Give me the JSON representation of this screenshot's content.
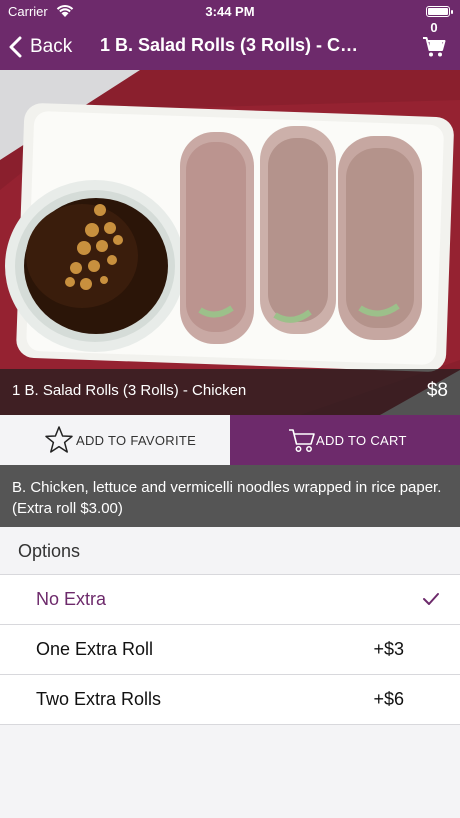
{
  "status_bar": {
    "carrier": "Carrier",
    "time": "3:44 PM"
  },
  "nav": {
    "back_label": "Back",
    "title": "1 B. Salad Rolls (3 Rolls) - Chicken",
    "cart_count": "0"
  },
  "item": {
    "name": "1 B. Salad Rolls (3 Rolls) - Chicken",
    "price": "$8",
    "description": "B. Chicken, lettuce and vermicelli noodles wrapped in rice paper. (Extra roll $3.00)"
  },
  "actions": {
    "favorite_label": "ADD TO FAVORITE",
    "cart_label": "ADD TO CART"
  },
  "options": {
    "header": "Options",
    "items": [
      {
        "label": "No Extra",
        "price": "",
        "selected": true
      },
      {
        "label": "One Extra Roll",
        "price": "+$3",
        "selected": false
      },
      {
        "label": "Two Extra Rolls",
        "price": "+$6",
        "selected": false
      }
    ]
  },
  "colors": {
    "brand": "#6d2a6b",
    "description_bg": "#555555",
    "background": "#f4f4f6"
  }
}
